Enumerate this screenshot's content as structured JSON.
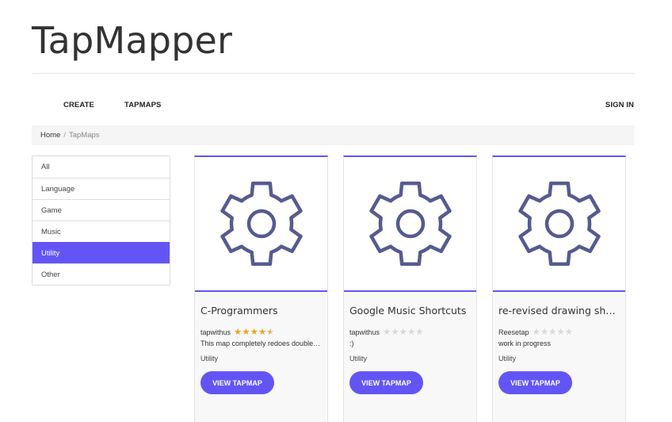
{
  "brand": {
    "title": "TapMapper"
  },
  "nav": {
    "create": "CREATE",
    "tapmaps": "TAPMAPS",
    "signin": "SIGN IN"
  },
  "breadcrumb": {
    "home": "Home",
    "separator": "/",
    "current": "TapMaps"
  },
  "filters": {
    "items": [
      "All",
      "Language",
      "Game",
      "Music",
      "Utility",
      "Other"
    ],
    "selected": "Utility"
  },
  "cards": [
    {
      "title": "C-Programmers",
      "author": "tapwithus",
      "rating": 4.5,
      "description": "This map completely redoes double-tap functionality",
      "category": "Utility",
      "button": "VIEW TAPMAP",
      "icon": "gear-icon"
    },
    {
      "title": "Google Music Shortcuts",
      "author": "tapwithus",
      "rating": 0,
      "description": ":)",
      "category": "Utility",
      "button": "VIEW TAPMAP",
      "icon": "gear-icon"
    },
    {
      "title": "re-revised drawing shortcuts",
      "author": "Reesetap",
      "rating": 0,
      "description": "work in progress",
      "category": "Utility",
      "button": "VIEW TAPMAP",
      "icon": "gear-icon"
    }
  ],
  "colors": {
    "accent": "#6355f5",
    "star": "#f0a51b",
    "gear": "#555b8f"
  }
}
